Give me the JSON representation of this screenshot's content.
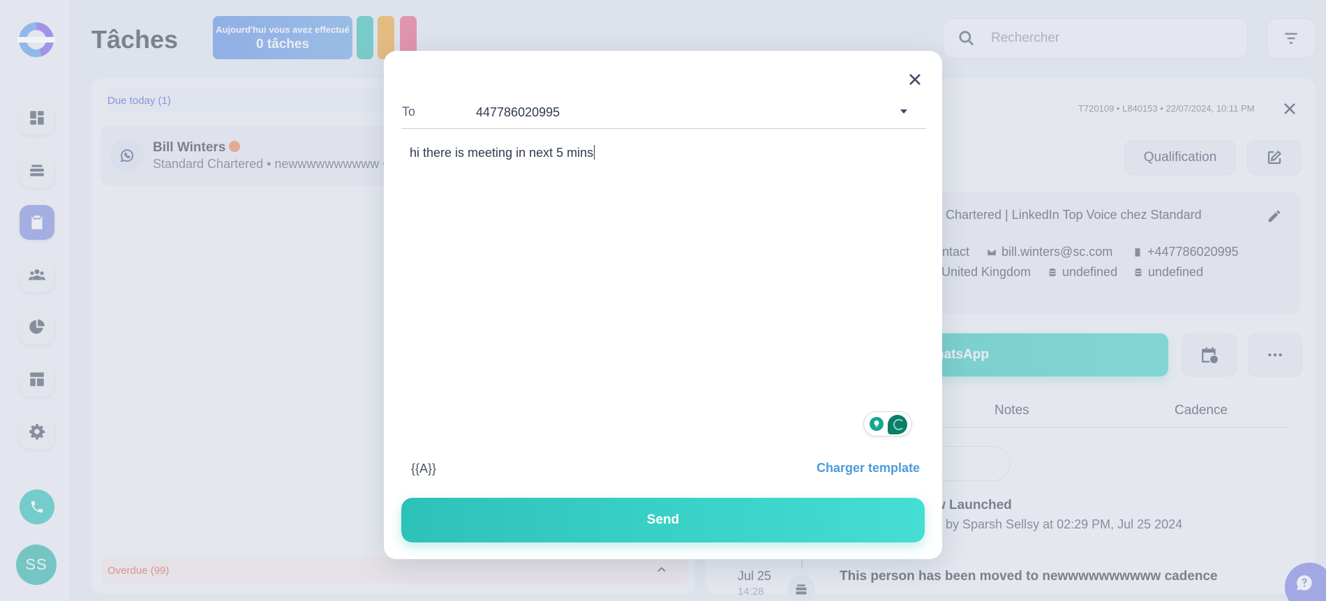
{
  "app": {
    "title": "Tâches"
  },
  "header": {
    "done_line1": "Aujourd'hui vous avez effectué",
    "done_line2": "0 tâches",
    "pill_colors": [
      "#2fc1b6",
      "#f0a636",
      "#ec5f86"
    ],
    "search_placeholder": "Rechercher"
  },
  "sidebar": {
    "items": [
      {
        "name": "dashboard-icon"
      },
      {
        "name": "stack-icon"
      },
      {
        "name": "tasks-icon",
        "active": true
      },
      {
        "name": "people-icon"
      },
      {
        "name": "pie-chart-icon"
      },
      {
        "name": "layout-icon"
      },
      {
        "name": "gear-icon"
      }
    ],
    "avatar_initials": "SS"
  },
  "tasks": {
    "due_today": "Due today (1)",
    "card": {
      "name": "Bill Winters",
      "subtitle": "Standard Chartered • newwwwwwwwww •"
    },
    "overdue": "Overdue (99)"
  },
  "detail": {
    "meta": "T720109 • L840153 • 22/07/2024, 10:11 PM",
    "qualification_label": "Qualification",
    "headline": "d Chartered | LinkedIn Top Voice chez Standard",
    "contact_items": [
      "ontact",
      "bill.winters@sc.com",
      "+447786020995",
      "United Kingdom",
      "undefined",
      "undefined"
    ],
    "whatsapp_label": "hatsApp",
    "tabs": [
      "Notes",
      "Cadence"
    ],
    "activity_title": "w Launched",
    "activity_sub": "d by Sparsh Sellsy at 02:29 PM, Jul 25 2024",
    "timeline_date": "Jul 25",
    "timeline_time": "14:28",
    "timeline_title": "This person has been moved to newwwwwwwwww cadence"
  },
  "modal": {
    "to_label": "To",
    "to_value": "447786020995",
    "message": "hi there is meeting in next 5 mins",
    "variable_label": "{{A}}",
    "template_link": "Charger template",
    "send_label": "Send"
  },
  "colors": {
    "accent": "#2dc2b8",
    "link": "#4a9bdc",
    "overdue": "#e05a4e",
    "due_today": "#4a5fd0"
  }
}
